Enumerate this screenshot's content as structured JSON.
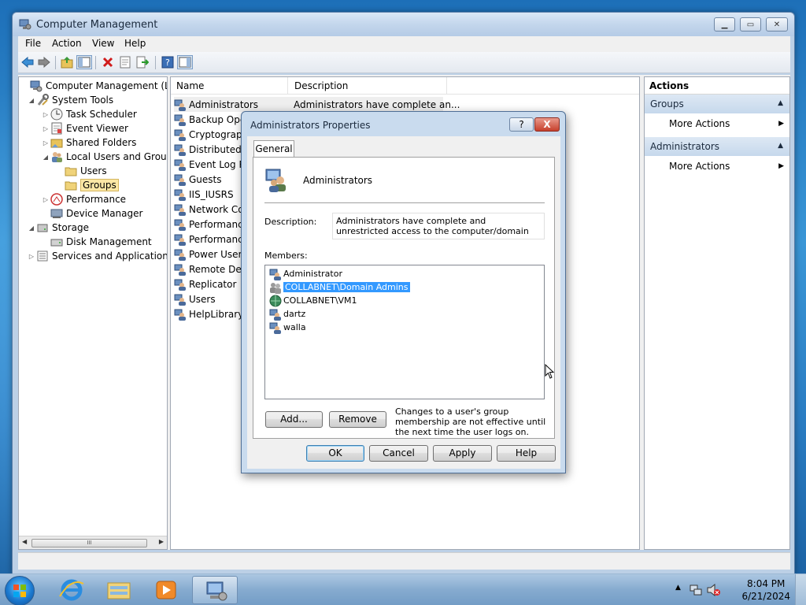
{
  "window": {
    "title": "Computer Management",
    "menu": [
      "File",
      "Action",
      "View",
      "Help"
    ]
  },
  "tree": {
    "items": [
      {
        "label": "Computer Management (Local",
        "icon": "computer-management-icon"
      },
      {
        "label": "System Tools",
        "icon": "tools-icon"
      },
      {
        "label": "Task Scheduler",
        "icon": "clock-icon"
      },
      {
        "label": "Event Viewer",
        "icon": "event-viewer-icon"
      },
      {
        "label": "Shared Folders",
        "icon": "shared-folder-icon"
      },
      {
        "label": "Local Users and Groups",
        "icon": "users-icon"
      },
      {
        "label": "Users",
        "icon": "folder-icon"
      },
      {
        "label": "Groups",
        "icon": "folder-icon"
      },
      {
        "label": "Performance",
        "icon": "performance-icon"
      },
      {
        "label": "Device Manager",
        "icon": "device-manager-icon"
      },
      {
        "label": "Storage",
        "icon": "storage-icon"
      },
      {
        "label": "Disk Management",
        "icon": "disk-icon"
      },
      {
        "label": "Services and Applications",
        "icon": "services-icon"
      }
    ],
    "scroll_label": "III"
  },
  "list": {
    "columns": [
      "Name",
      "Description"
    ],
    "rows": [
      {
        "name": "Administrators",
        "desc": "Administrators have complete an..."
      },
      {
        "name": "Backup Oper",
        "desc": ""
      },
      {
        "name": "Cryptograph",
        "desc": ""
      },
      {
        "name": "Distributed C",
        "desc": ""
      },
      {
        "name": "Event Log Re",
        "desc": ""
      },
      {
        "name": "Guests",
        "desc": ""
      },
      {
        "name": "IIS_IUSRS",
        "desc": ""
      },
      {
        "name": "Network Con",
        "desc": ""
      },
      {
        "name": "Performance",
        "desc": ""
      },
      {
        "name": "Performance",
        "desc": ""
      },
      {
        "name": "Power Users",
        "desc": ""
      },
      {
        "name": "Remote Desk",
        "desc": ""
      },
      {
        "name": "Replicator",
        "desc": ""
      },
      {
        "name": "Users",
        "desc": ""
      },
      {
        "name": "HelpLibraryU",
        "desc": ""
      }
    ]
  },
  "actions": {
    "header": "Actions",
    "sections": [
      {
        "title": "Groups",
        "item": "More Actions"
      },
      {
        "title": "Administrators",
        "item": "More Actions"
      }
    ]
  },
  "dialog": {
    "title": "Administrators Properties",
    "help_label": "?",
    "close_label": "X",
    "tab": "General",
    "group_name": "Administrators",
    "description_label": "Description:",
    "description_value": "Administrators have complete and unrestricted access to the computer/domain",
    "members_label": "Members:",
    "members": [
      {
        "name": "Administrator",
        "selected": false
      },
      {
        "name": "COLLABNET\\Domain Admins",
        "selected": true
      },
      {
        "name": "COLLABNET\\VM1",
        "selected": false
      },
      {
        "name": "dartz",
        "selected": false
      },
      {
        "name": "walla",
        "selected": false
      }
    ],
    "add_label": "Add...",
    "remove_label": "Remove",
    "note": "Changes to a user's group membership are not effective until the next time the user logs on.",
    "ok_label": "OK",
    "cancel_label": "Cancel",
    "apply_label": "Apply",
    "helpbtn_label": "Help"
  },
  "taskbar": {
    "time": "8:04 PM",
    "date": "6/21/2024"
  },
  "colors": {
    "selection": "#3399ff",
    "tree_selected": "#fbe7a5",
    "action_section": "#c6d8ec"
  }
}
